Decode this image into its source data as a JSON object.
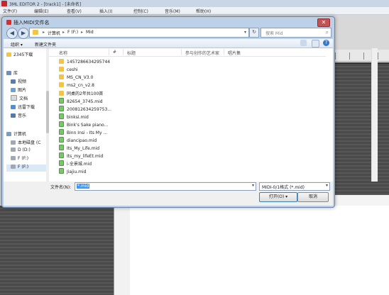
{
  "app": {
    "title": "3ML EDITOR 2 - [track1] - [未命名]",
    "menu": [
      "文件(F)",
      "编辑(E)",
      "查看(V)",
      "插入(I)",
      "控制(C)",
      "音乐(M)",
      "帮助(H)"
    ]
  },
  "dialog": {
    "title": "插入MIDI文件名",
    "close_label": "✕",
    "back_label": "◀",
    "forward_label": "▶",
    "address": {
      "path": [
        "计算机",
        "F (F:)",
        "Mid"
      ],
      "sep": "▸"
    },
    "refresh_label": "↻",
    "search_placeholder": "搜索 Mid",
    "search_icon_glyph": "⌕",
    "toolbar": {
      "organize": "组织 ▾",
      "new_folder": "新建文件夹",
      "help_glyph": "?"
    },
    "sidebar": [
      {
        "label": "2345下载",
        "icon": "folder-icon",
        "color": "#f4c542"
      },
      {
        "label": "库",
        "icon": "library-icon",
        "color": "#6f8fb8"
      },
      {
        "label": "视频",
        "icon": "video-icon",
        "color": "#5b7cad"
      },
      {
        "label": "图片",
        "icon": "picture-icon",
        "color": "#6aa0d4"
      },
      {
        "label": "文档",
        "icon": "document-icon",
        "color": "#d9d9d9"
      },
      {
        "label": "迅雷下载",
        "icon": "thunder-download-icon",
        "color": "#4d8fd6"
      },
      {
        "label": "音乐",
        "icon": "music-icon",
        "color": "#4f79b8"
      },
      {
        "label": "计算机",
        "icon": "computer-icon",
        "color": "#7c9bc0"
      },
      {
        "label": "本地磁盘 (C",
        "icon": "disk-icon",
        "color": "#a0a8b4"
      },
      {
        "label": "D (D:)",
        "icon": "disk-icon",
        "color": "#a0a8b4"
      },
      {
        "label": "F (F:)",
        "icon": "disk-icon",
        "color": "#a0a8b4"
      },
      {
        "label": "F (F:)",
        "icon": "disk-icon",
        "color": "#a0a8b4"
      }
    ],
    "columns": [
      "名称",
      "#",
      "标题",
      "参与创作的艺术家",
      "唱片集"
    ],
    "files": [
      {
        "name": "1457286634295744",
        "type": "folder"
      },
      {
        "name": "ceshi",
        "type": "folder"
      },
      {
        "name": "MS_CN_V3.0",
        "type": "folder"
      },
      {
        "name": "ms2_cn_v2.8",
        "type": "folder"
      },
      {
        "name": "同桌的2年共100首",
        "type": "folder"
      },
      {
        "name": "82654_3745.mid",
        "type": "mid"
      },
      {
        "name": "200812634259753...",
        "type": "mid"
      },
      {
        "name": "binksi.mid",
        "type": "mid"
      },
      {
        "name": "Bink's Sake piano...",
        "type": "mid"
      },
      {
        "name": "Binn Insi - Its My ...",
        "type": "mid"
      },
      {
        "name": "diancipao.mid",
        "type": "mid"
      },
      {
        "name": "Its_My_Life.mid",
        "type": "mid"
      },
      {
        "name": "Its_my_lifeEt.mid",
        "type": "mid"
      },
      {
        "name": "i-全景城.mid",
        "type": "mid"
      },
      {
        "name": "Jiajiu.mid",
        "type": "mid"
      }
    ],
    "filename_label": "文件名(N):",
    "filename_value": "*.mid",
    "filetype_value": "MIDI-0/1格式 (*.mid)",
    "dropdown_glyph": "▾",
    "open_label": "打开(O) ▾",
    "cancel_label": "取消"
  }
}
